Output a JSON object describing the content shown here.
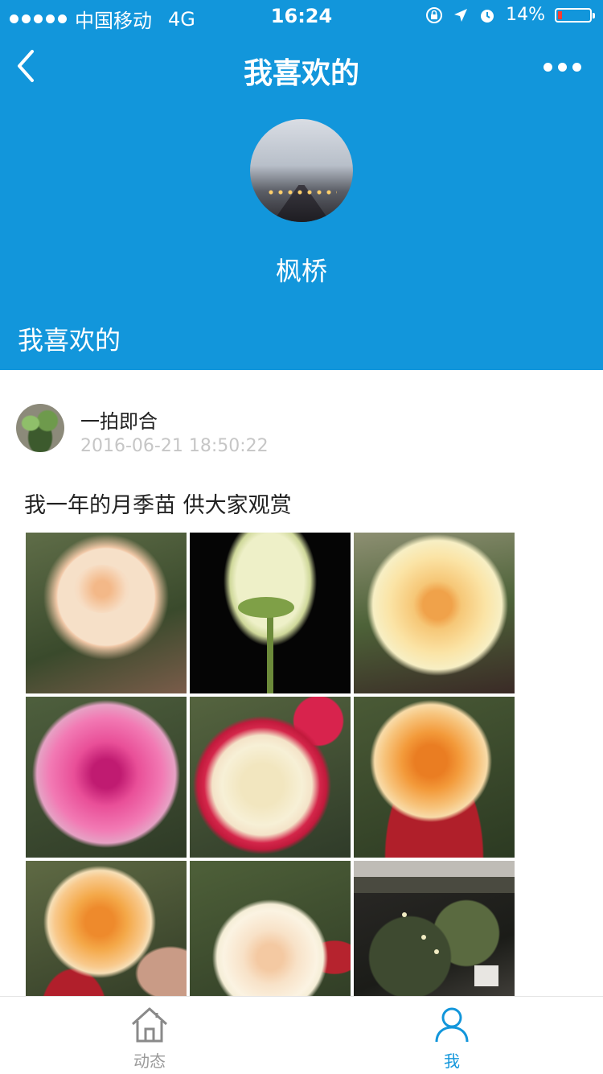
{
  "status_bar": {
    "carrier": "中国移动",
    "network": "4G",
    "time": "16:24",
    "battery": "14%"
  },
  "nav": {
    "title": "我喜欢的"
  },
  "profile": {
    "name": "枫桥"
  },
  "section": {
    "title": "我喜欢的"
  },
  "post": {
    "author": "一拍即合",
    "time": "2016-06-21 18:50:22",
    "text": "我一年的月季苗 供大家观赏",
    "photos": [
      {
        "subject": "peach-rose"
      },
      {
        "subject": "white-rose-bud"
      },
      {
        "subject": "yellow-rose"
      },
      {
        "subject": "pink-rose"
      },
      {
        "subject": "red-white-rose"
      },
      {
        "subject": "orange-rose"
      },
      {
        "subject": "orange-rose-in-hand"
      },
      {
        "subject": "cream-rose"
      },
      {
        "subject": "balcony-garden"
      }
    ]
  },
  "tabbar": {
    "home_label": "动态",
    "me_label": "我"
  },
  "colors": {
    "header_blue": "#1296db",
    "battery_low": "#ff3b30",
    "inactive_tab": "#9a9a9a"
  }
}
